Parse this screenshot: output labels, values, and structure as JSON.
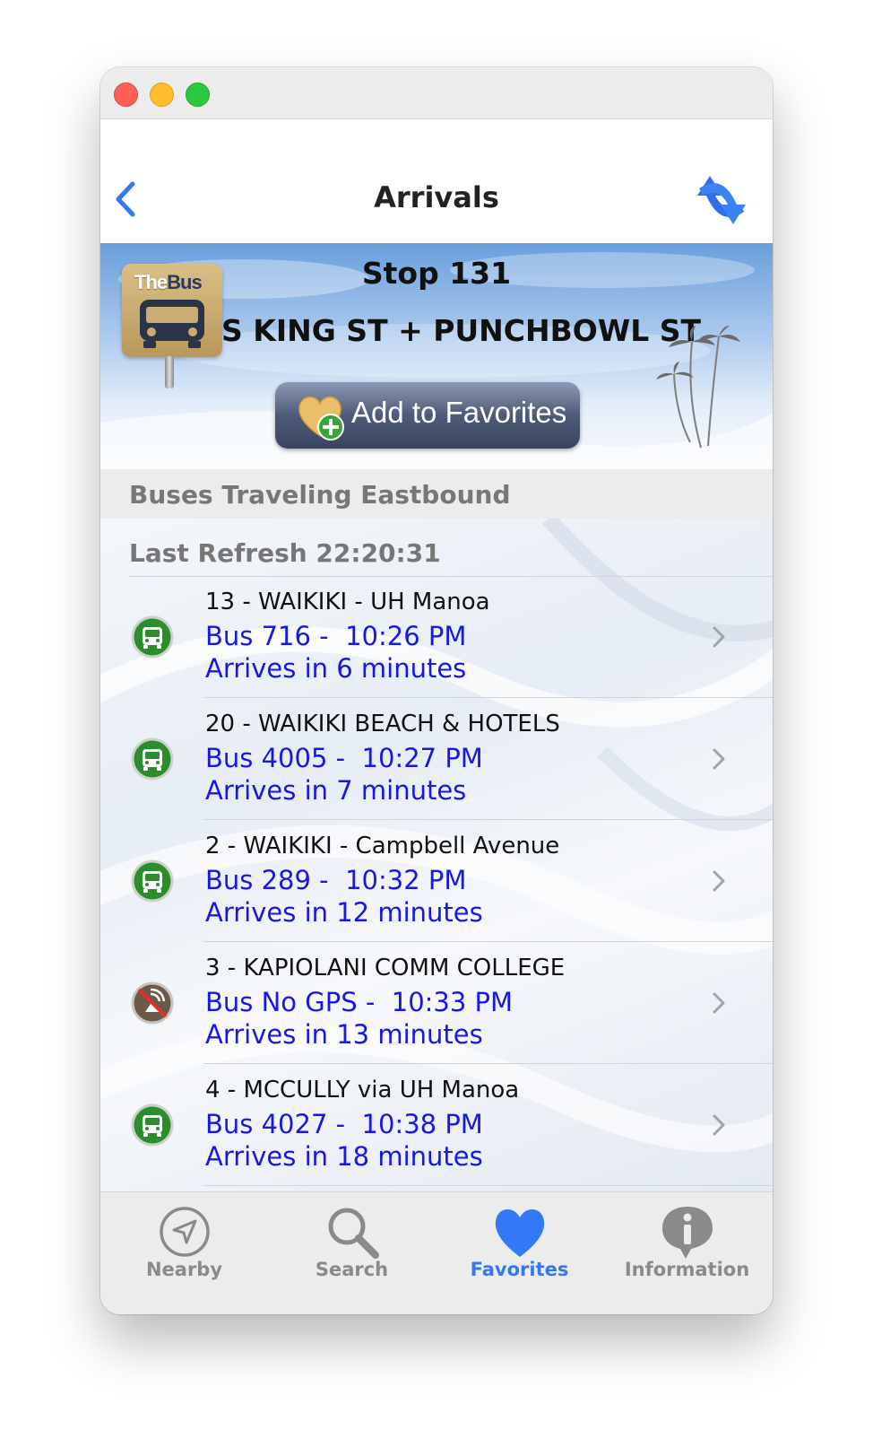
{
  "window": {
    "controls": [
      "close",
      "minimize",
      "zoom"
    ]
  },
  "navbar": {
    "title": "Arrivals",
    "back_icon": "chevron-left-icon",
    "refresh_icon": "refresh-arrows-icon"
  },
  "stop": {
    "title": "Stop 131",
    "name": "S KING ST + PUNCHBOWL ST",
    "logo_text_1": "The",
    "logo_text_2": "Bus",
    "favorite_button": "Add to Favorites"
  },
  "section": {
    "title": "Buses Traveling Eastbound",
    "last_refresh": "Last Refresh 22:20:31"
  },
  "arrivals": [
    {
      "route": "13 - WAIKIKI - UH Manoa",
      "bus": "Bus 716 -  10:26 PM",
      "arrives": "Arrives in 6 minutes",
      "icon": "bus-gps-icon"
    },
    {
      "route": "20 - WAIKIKI BEACH & HOTELS",
      "bus": "Bus 4005 -  10:27 PM",
      "arrives": "Arrives in 7 minutes",
      "icon": "bus-gps-icon"
    },
    {
      "route": "2 - WAIKIKI - Campbell Avenue",
      "bus": "Bus 289 -  10:32 PM",
      "arrives": "Arrives in 12 minutes",
      "icon": "bus-gps-icon"
    },
    {
      "route": "3 - KAPIOLANI COMM COLLEGE",
      "bus": "Bus No GPS -  10:33 PM",
      "arrives": "Arrives in 13 minutes",
      "icon": "no-gps-icon"
    },
    {
      "route": "4 - MCCULLY via UH Manoa",
      "bus": "Bus 4027 -  10:38 PM",
      "arrives": "Arrives in 18 minutes",
      "icon": "bus-gps-icon"
    }
  ],
  "tabs": [
    {
      "label": "Nearby",
      "icon": "location-arrow-icon",
      "active": false
    },
    {
      "label": "Search",
      "icon": "search-icon",
      "active": false
    },
    {
      "label": "Favorites",
      "icon": "heart-icon",
      "active": true
    },
    {
      "label": "Information",
      "icon": "info-icon",
      "active": false
    }
  ],
  "colors": {
    "accent": "#3478f6",
    "link_blue": "#1717e6",
    "bus_icon_green": "#2e8b2e"
  }
}
